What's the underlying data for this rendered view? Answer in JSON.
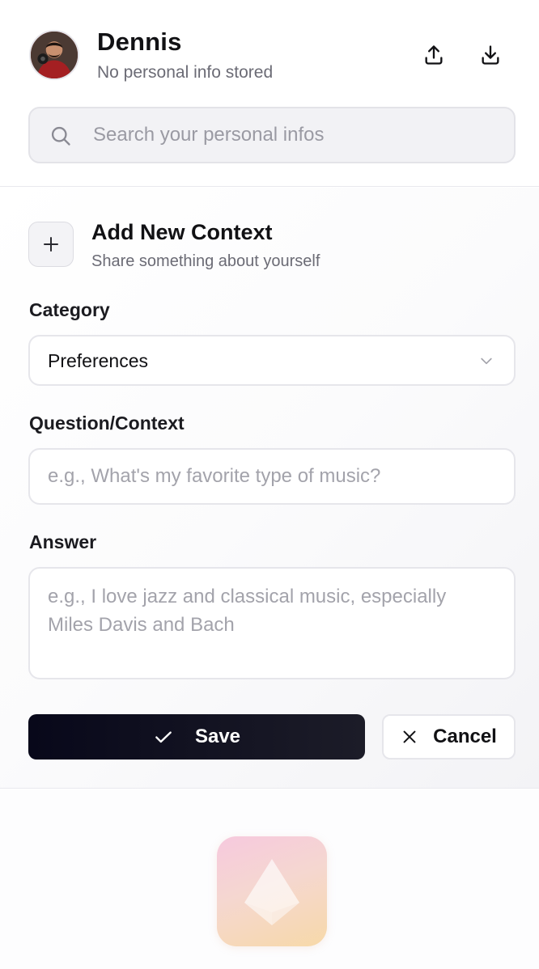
{
  "user": {
    "name": "Dennis",
    "subtitle": "No personal info stored"
  },
  "header": {
    "upload_icon": "upload-icon",
    "download_icon": "download-icon"
  },
  "search": {
    "placeholder": "Search your personal infos",
    "icon": "search-icon"
  },
  "add_context": {
    "title": "Add New Context",
    "subtitle": "Share something about yourself",
    "icon": "plus-icon"
  },
  "form": {
    "category_label": "Category",
    "category_value": "Preferences",
    "question_label": "Question/Context",
    "question_placeholder": "e.g., What's my favorite type of music?",
    "answer_label": "Answer",
    "answer_placeholder": "e.g., I love jazz and classical music, especially Miles Davis and Bach"
  },
  "actions": {
    "save_label": "Save",
    "cancel_label": "Cancel"
  },
  "colors": {
    "primary_button": "#0a0a18",
    "muted_text": "#6b6b75",
    "placeholder": "#a3a3ab",
    "border": "#e6e6eb"
  }
}
